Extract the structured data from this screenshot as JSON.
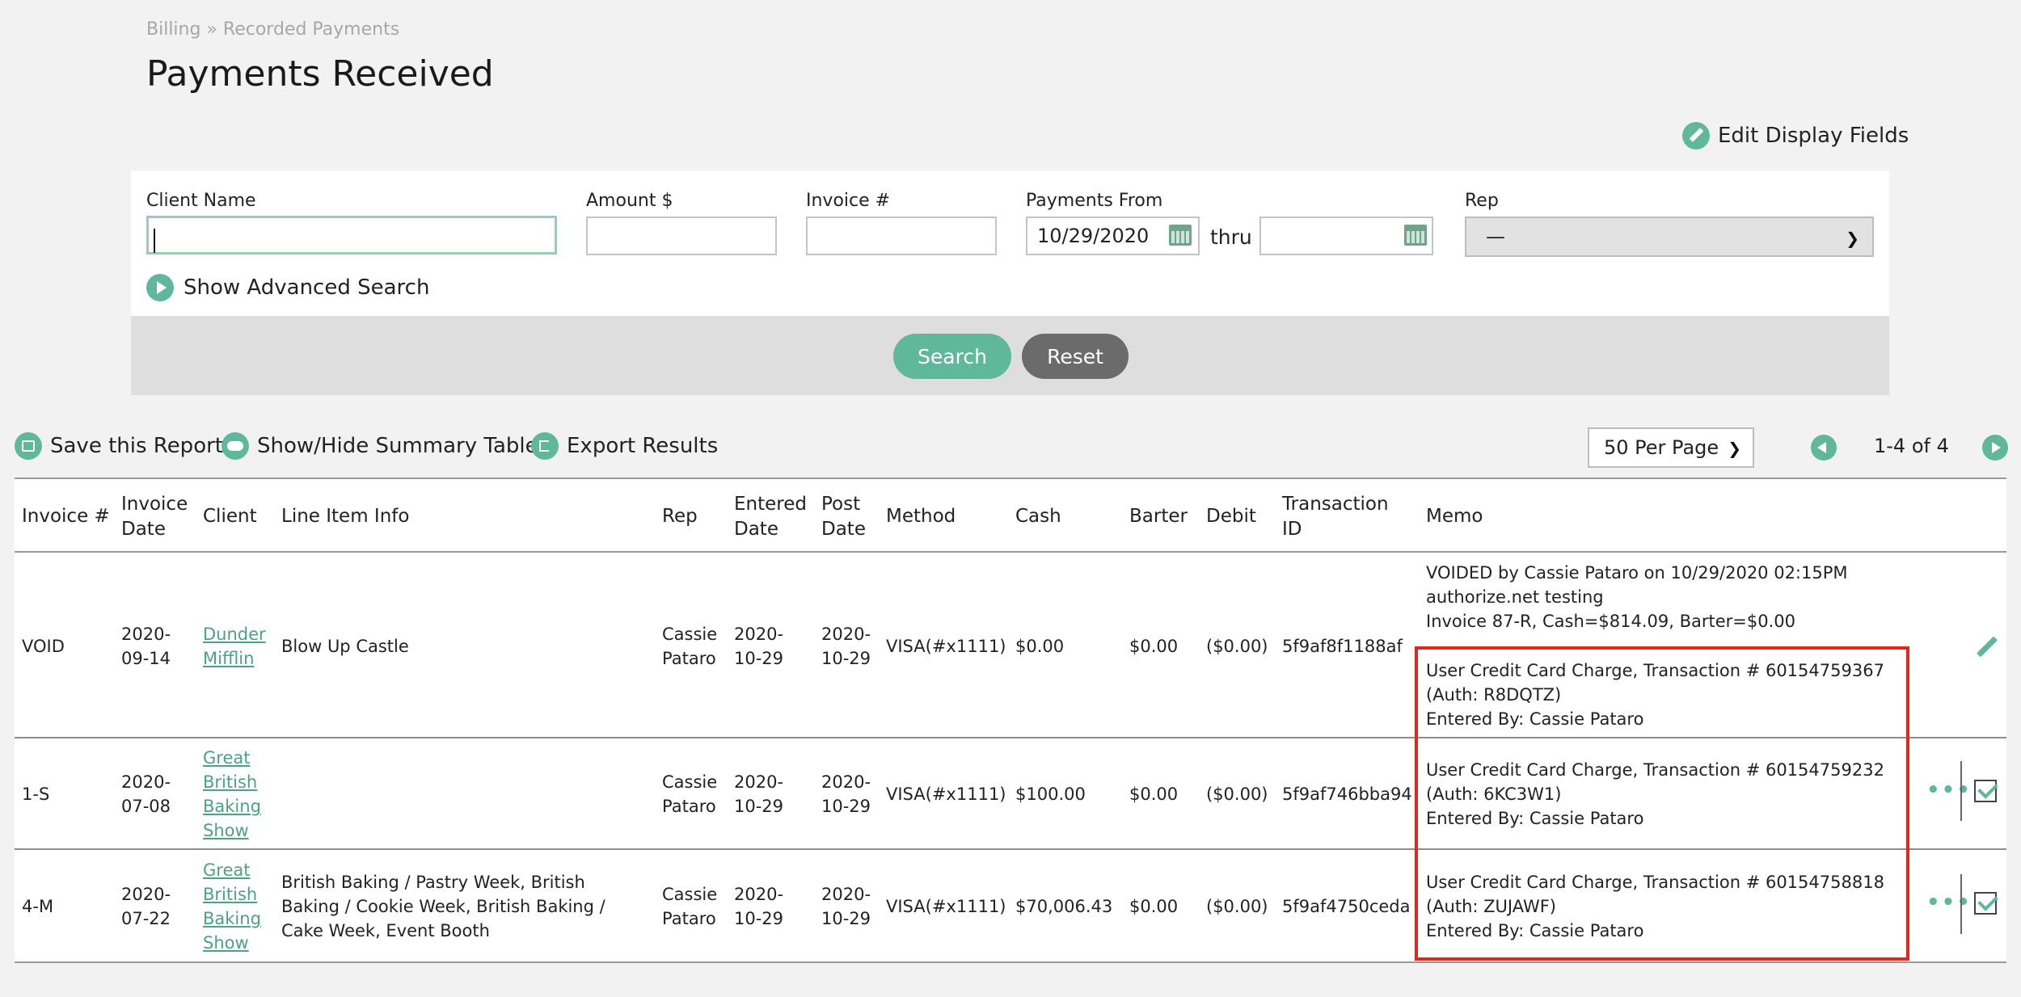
{
  "header": {
    "breadcrumb": "Billing » Recorded Payments",
    "title": "Payments Received",
    "edit_display_fields": "Edit Display Fields"
  },
  "search": {
    "client_name_label": "Client Name",
    "client_name_value": "",
    "amount_label": "Amount $",
    "amount_value": "",
    "invoice_label": "Invoice #",
    "invoice_value": "",
    "payments_from_label": "Payments From",
    "payments_from_value": "10/29/2020",
    "thru_label": "thru",
    "payments_to_value": "",
    "rep_label": "Rep",
    "rep_value": "—",
    "advanced_search": "Show Advanced Search",
    "search_button": "Search",
    "reset_button": "Reset"
  },
  "toolbar": {
    "save_report": "Save this Report",
    "show_hide_summary": "Show/Hide Summary Table",
    "export_results": "Export Results",
    "per_page": "50 Per Page",
    "range": "1-4 of 4"
  },
  "table": {
    "columns": [
      "Invoice #",
      "Invoice Date",
      "Client",
      "Line Item Info",
      "Rep",
      "Entered Date",
      "Post Date",
      "Method",
      "Cash",
      "Barter",
      "Debit",
      "Transaction ID",
      "Memo"
    ],
    "rows": [
      {
        "invoice": "VOID",
        "invoice_date": "2020- 09-14",
        "client": "Dunder Mifflin",
        "line_item": "Blow Up Castle",
        "rep": "Cassie Pataro",
        "entered": "2020- 10-29",
        "post": "2020- 10-29",
        "method": "VISA(#x1111)",
        "cash": "$0.00",
        "barter": "$0.00",
        "debit": "($0.00)",
        "txn": "5f9af8f1188af",
        "memo_top": [
          "VOIDED by Cassie Pataro on 10/29/2020 02:15PM",
          "authorize.net testing",
          "Invoice 87-R, Cash=$814.09, Barter=$0.00"
        ],
        "memo": [
          "User Credit Card Charge, Transaction # 60154759367",
          "(Auth: R8DQTZ)",
          "Entered By: Cassie Pataro"
        ]
      },
      {
        "invoice": "1-S",
        "invoice_date": "2020- 07-08",
        "client": "Great British Baking Show",
        "line_item": "",
        "rep": "Cassie Pataro",
        "entered": "2020- 10-29",
        "post": "2020- 10-29",
        "method": "VISA(#x1111)",
        "cash": "$100.00",
        "barter": "$0.00",
        "debit": "($0.00)",
        "txn": "5f9af746bba94",
        "memo": [
          "User Credit Card Charge, Transaction # 60154759232",
          "(Auth: 6KC3W1)",
          "Entered By: Cassie Pataro"
        ]
      },
      {
        "invoice": "4-M",
        "invoice_date": "2020- 07-22",
        "client": "Great British Baking Show",
        "line_item": "British Baking / Pastry Week, British Baking / Cookie Week, British Baking / Cake Week, Event Booth",
        "rep": "Cassie Pataro",
        "entered": "2020- 10-29",
        "post": "2020- 10-29",
        "method": "VISA(#x1111)",
        "cash": "$70,006.43",
        "barter": "$0.00",
        "debit": "($0.00)",
        "txn": "5f9af4750ceda",
        "memo": [
          "User Credit Card Charge, Transaction # 60154758818",
          "(Auth: ZUJAWF)",
          "Entered By: Cassie Pataro"
        ]
      }
    ]
  },
  "colors": {
    "accent": "#5fb89a",
    "highlight": "#e2281d"
  }
}
